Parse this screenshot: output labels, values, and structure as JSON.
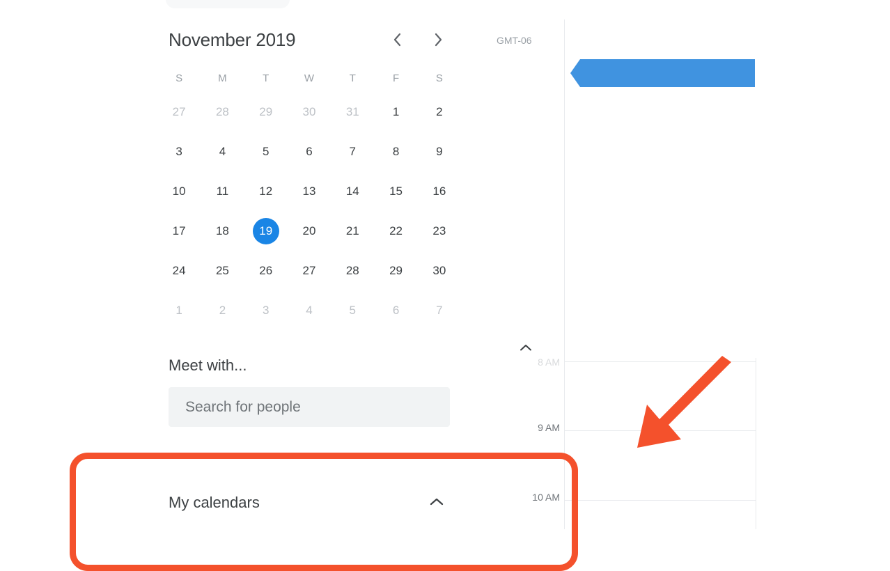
{
  "mini_calendar": {
    "title": "November 2019",
    "prev_icon": "chevron-left-icon",
    "next_icon": "chevron-right-icon",
    "weekday_headers": [
      "S",
      "M",
      "T",
      "W",
      "T",
      "F",
      "S"
    ],
    "weeks": [
      [
        {
          "day": "27",
          "muted": true,
          "selected": false
        },
        {
          "day": "28",
          "muted": true,
          "selected": false
        },
        {
          "day": "29",
          "muted": true,
          "selected": false
        },
        {
          "day": "30",
          "muted": true,
          "selected": false
        },
        {
          "day": "31",
          "muted": true,
          "selected": false
        },
        {
          "day": "1",
          "muted": false,
          "selected": false
        },
        {
          "day": "2",
          "muted": false,
          "selected": false
        }
      ],
      [
        {
          "day": "3",
          "muted": false,
          "selected": false
        },
        {
          "day": "4",
          "muted": false,
          "selected": false
        },
        {
          "day": "5",
          "muted": false,
          "selected": false
        },
        {
          "day": "6",
          "muted": false,
          "selected": false
        },
        {
          "day": "7",
          "muted": false,
          "selected": false
        },
        {
          "day": "8",
          "muted": false,
          "selected": false
        },
        {
          "day": "9",
          "muted": false,
          "selected": false
        }
      ],
      [
        {
          "day": "10",
          "muted": false,
          "selected": false
        },
        {
          "day": "11",
          "muted": false,
          "selected": false
        },
        {
          "day": "12",
          "muted": false,
          "selected": false
        },
        {
          "day": "13",
          "muted": false,
          "selected": false
        },
        {
          "day": "14",
          "muted": false,
          "selected": false
        },
        {
          "day": "15",
          "muted": false,
          "selected": false
        },
        {
          "day": "16",
          "muted": false,
          "selected": false
        }
      ],
      [
        {
          "day": "17",
          "muted": false,
          "selected": false
        },
        {
          "day": "18",
          "muted": false,
          "selected": false
        },
        {
          "day": "19",
          "muted": false,
          "selected": true
        },
        {
          "day": "20",
          "muted": false,
          "selected": false
        },
        {
          "day": "21",
          "muted": false,
          "selected": false
        },
        {
          "day": "22",
          "muted": false,
          "selected": false
        },
        {
          "day": "23",
          "muted": false,
          "selected": false
        }
      ],
      [
        {
          "day": "24",
          "muted": false,
          "selected": false
        },
        {
          "day": "25",
          "muted": false,
          "selected": false
        },
        {
          "day": "26",
          "muted": false,
          "selected": false
        },
        {
          "day": "27",
          "muted": false,
          "selected": false
        },
        {
          "day": "28",
          "muted": false,
          "selected": false
        },
        {
          "day": "29",
          "muted": false,
          "selected": false
        },
        {
          "day": "30",
          "muted": false,
          "selected": false
        }
      ],
      [
        {
          "day": "1",
          "muted": true,
          "selected": false
        },
        {
          "day": "2",
          "muted": true,
          "selected": false
        },
        {
          "day": "3",
          "muted": true,
          "selected": false
        },
        {
          "day": "4",
          "muted": true,
          "selected": false
        },
        {
          "day": "5",
          "muted": true,
          "selected": false
        },
        {
          "day": "6",
          "muted": true,
          "selected": false
        },
        {
          "day": "7",
          "muted": true,
          "selected": false
        }
      ]
    ],
    "selected_day": "19",
    "selected_color": "#1a85e5"
  },
  "meet_with": {
    "title": "Meet with...",
    "search_placeholder": "Search for people",
    "search_value": ""
  },
  "my_calendars": {
    "label": "My calendars",
    "chevron_icon": "chevron-up-icon",
    "expanded": true
  },
  "day_grid": {
    "timezone_label": "GMT-06",
    "collapse_icon": "chevron-up-icon",
    "hour_labels": [
      "8 AM",
      "9 AM",
      "10 AM"
    ],
    "all_day_event": {
      "color": "#4093e0",
      "label": ""
    }
  },
  "annotations": {
    "color": "#f4512c",
    "highlight_box": "my-calendars-highlight",
    "arrow": "pointer-arrow-down-left"
  }
}
